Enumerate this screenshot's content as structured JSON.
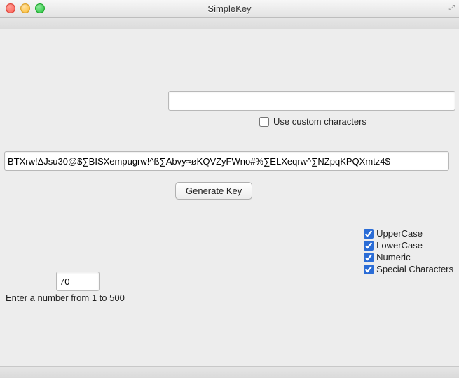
{
  "window": {
    "title": "SimpleKey"
  },
  "custom_chars": {
    "value": "",
    "checkbox_label": "Use custom characters",
    "checked": false
  },
  "result": {
    "value": "BTXrw!ΔJsu30@$∑BISXempugrw!^ß∑Abvy≈øKQVZyFWno#%∑ELXeqrw^∑NZpqKPQXmtz4$"
  },
  "generate": {
    "label": "Generate Key"
  },
  "options": {
    "uppercase": {
      "label": "UpperCase",
      "checked": true
    },
    "lowercase": {
      "label": "LowerCase",
      "checked": true
    },
    "numeric": {
      "label": "Numeric",
      "checked": true
    },
    "special": {
      "label": "Special Characters",
      "checked": true
    }
  },
  "length": {
    "value": "70",
    "hint": "Enter a number from 1 to 500"
  }
}
